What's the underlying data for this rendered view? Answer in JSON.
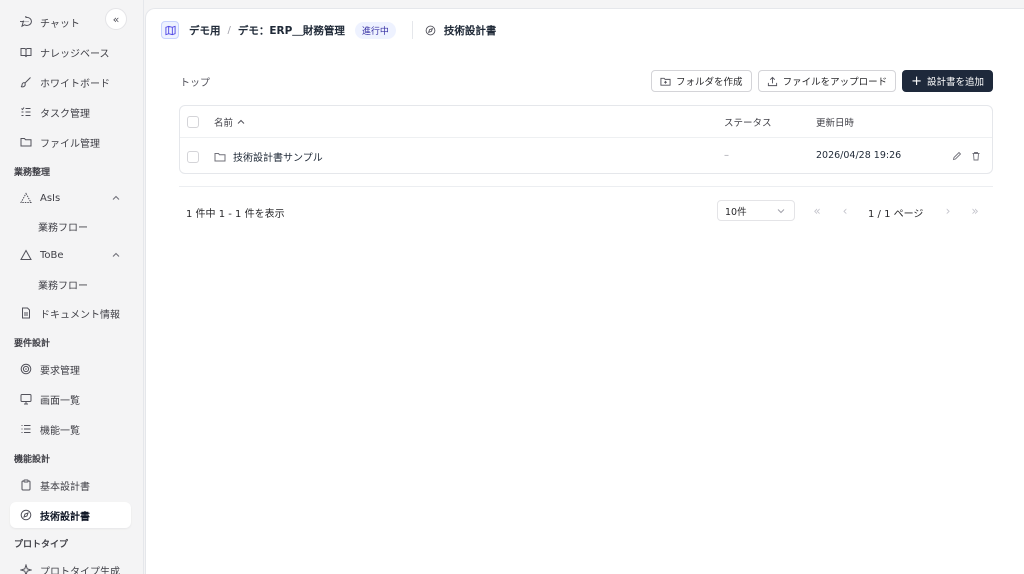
{
  "sidebar": {
    "items": [
      {
        "label": "チャット",
        "icon": "chat-bubble-icon"
      },
      {
        "label": "ナレッジベース",
        "icon": "book-icon"
      },
      {
        "label": "ホワイトボード",
        "icon": "brush-icon"
      },
      {
        "label": "タスク管理",
        "icon": "task-list-icon"
      },
      {
        "label": "ファイル管理",
        "icon": "folder-icon"
      }
    ],
    "sections": [
      {
        "label": "業務整理"
      },
      {
        "label": "要件設計"
      },
      {
        "label": "機能設計"
      },
      {
        "label": "プロトタイプ"
      }
    ],
    "gyomu": [
      {
        "label": "AsIs",
        "icon": "triangle-nodes-icon"
      },
      {
        "label": "業務フロー"
      },
      {
        "label": "ToBe",
        "icon": "triangle-icon"
      },
      {
        "label": "業務フロー"
      },
      {
        "label": "ドキュメント情報",
        "icon": "document-icon"
      }
    ],
    "youken": [
      {
        "label": "要求管理",
        "icon": "target-icon"
      },
      {
        "label": "画面一覧",
        "icon": "monitor-icon"
      },
      {
        "label": "機能一覧",
        "icon": "list-icon"
      }
    ],
    "kinou": [
      {
        "label": "基本設計書",
        "icon": "clipboard-icon"
      },
      {
        "label": "技術設計書",
        "icon": "compass-icon"
      }
    ],
    "proto": [
      {
        "label": "プロトタイプ生成",
        "icon": "sparkle-icon"
      }
    ]
  },
  "header": {
    "project": "デモ用",
    "separator": "/",
    "subproject": "デモ：ERP＿財務管理",
    "status": "進行中",
    "page_title": "技術設計書"
  },
  "content": {
    "breadcrumb_root": "トップ",
    "buttons": {
      "create_folder": "フォルダを作成",
      "upload_file": "ファイルをアップロード",
      "add_doc": "設計書を追加"
    },
    "table": {
      "columns": {
        "name": "名前",
        "status": "ステータス",
        "updated": "更新日時"
      },
      "rows": [
        {
          "name": "技術設計書サンプル",
          "status": "–",
          "updated": "2026/04/28 19:26"
        }
      ]
    },
    "pagination": {
      "summary": "1 件中 1 - 1 件を表示",
      "page_size": "10件",
      "page_indicator": "1 / 1 ページ"
    }
  },
  "colors": {
    "primary": "#1e293b",
    "badge_bg": "#eef2ff",
    "badge_text": "#3730a3"
  }
}
